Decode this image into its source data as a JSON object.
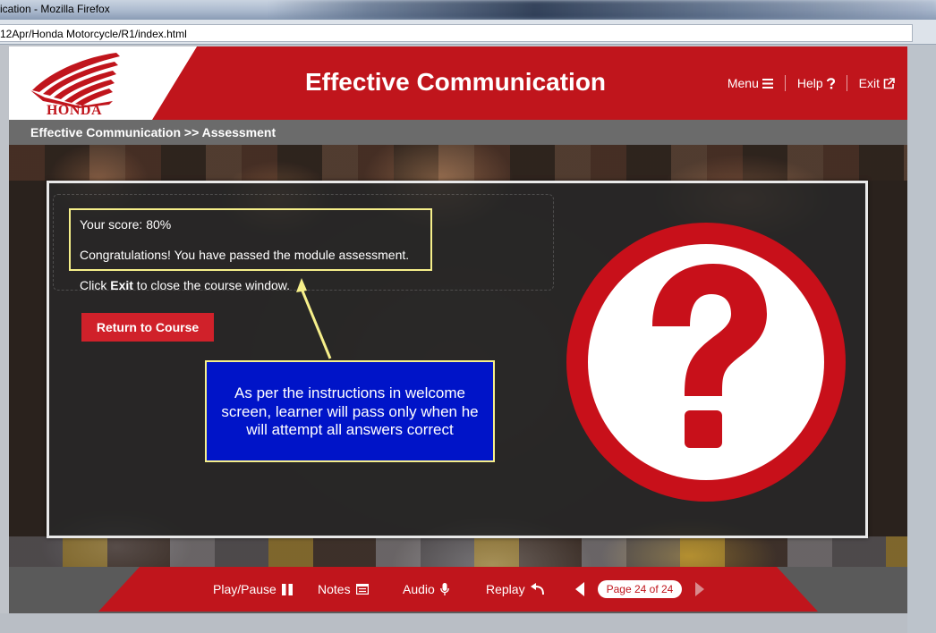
{
  "browser": {
    "window_title": "ication - Mozilla Firefox",
    "url": "12Apr/Honda Motorcycle/R1/index.html"
  },
  "header": {
    "logo_text": "HONDA",
    "course_title": "Effective Communication",
    "nav": {
      "menu_label": "Menu",
      "help_label": "Help",
      "exit_label": "Exit"
    }
  },
  "breadcrumb": "Effective Communication >> Assessment",
  "result": {
    "score_text": "Your score: 80%",
    "congrats_text": "Congratulations! You have passed the module assessment.",
    "instruction_prefix": "Click ",
    "instruction_bold": "Exit",
    "instruction_suffix": " to close the course window.",
    "return_button_label": "Return to Course"
  },
  "callout": {
    "text": "As per the instructions in welcome screen, learner will pass only when he will attempt all answers correct"
  },
  "question_graphic": {
    "icon": "question-mark-icon",
    "color": "#c8101a"
  },
  "footer": {
    "play_pause_label": "Play/Pause",
    "notes_label": "Notes",
    "audio_label": "Audio",
    "replay_label": "Replay",
    "page_indicator": "Page 24 of 24"
  },
  "colors": {
    "brand_red": "#c0151c",
    "callout_blue": "#0014c8",
    "highlight_yellow": "#f6ef8a"
  }
}
